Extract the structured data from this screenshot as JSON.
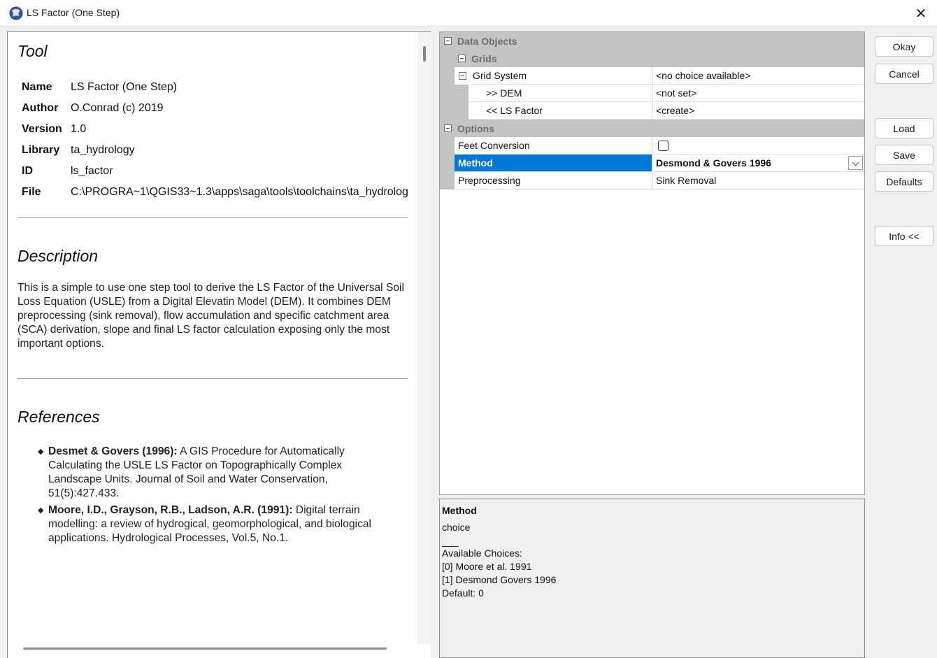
{
  "window": {
    "title": "LS Factor (One Step)",
    "close_glyph": "✕",
    "icon": "globe-app-icon"
  },
  "info": {
    "tool_heading": "Tool",
    "fields": [
      {
        "key": "Name",
        "value": "LS Factor (One Step)"
      },
      {
        "key": "Author",
        "value": "O.Conrad (c) 2019"
      },
      {
        "key": "Version",
        "value": "1.0"
      },
      {
        "key": "Library",
        "value": "ta_hydrology"
      },
      {
        "key": "ID",
        "value": "ls_factor"
      },
      {
        "key": "File",
        "value": "C:\\PROGRA~1\\QGIS33~1.3\\apps\\saga\\tools\\toolchains\\ta_hydrolog"
      }
    ],
    "description_heading": "Description",
    "description": "This is a simple to use one step tool to derive the LS Factor of the Universal Soil Loss Equation (USLE) from a Digital Elevatin Model (DEM). It combines DEM preprocessing (sink removal), flow accumulation and specific catchment area (SCA) derivation, slope and final LS factor calculation exposing only the most important options.",
    "references_heading": "References",
    "references": [
      {
        "title": "Desmet & Govers (1996):",
        "text": " A GIS Procedure for Automatically Calculating the USLE LS Factor on Topographically Complex Landscape Units. Journal of Soil and Water Conservation, 51(5):427.433."
      },
      {
        "title": "Moore, I.D., Grayson, R.B., Ladson, A.R. (1991):",
        "text": " Digital terrain modelling: a review of hydrogical, geomorphological, and biological applications. Hydrological Processes, Vol.5, No.1."
      }
    ]
  },
  "properties": {
    "data_objects": "Data Objects",
    "grids": "Grids",
    "grid_system": {
      "name": "Grid System",
      "value": "<no choice available>"
    },
    "dem": {
      "name": ">> DEM",
      "value": "<not set>"
    },
    "ls_factor": {
      "name": "<< LS Factor",
      "value": "<create>"
    },
    "options": "Options",
    "feet_conversion": {
      "name": "Feet Conversion",
      "checked": false
    },
    "method": {
      "name": "Method",
      "value": "Desmond & Govers 1996"
    },
    "preprocessing": {
      "name": "Preprocessing",
      "value": "Sink Removal"
    }
  },
  "description_box": {
    "title": "Method",
    "type": "choice",
    "separator": "___",
    "choices_label": "Available Choices:",
    "choice_0": "[0] Moore et al. 1991",
    "choice_1": "[1] Desmond  Govers 1996",
    "default": "Default: 0"
  },
  "buttons": {
    "okay": "Okay",
    "cancel": "Cancel",
    "load": "Load",
    "save": "Save",
    "defaults": "Defaults",
    "info": "Info <<"
  }
}
